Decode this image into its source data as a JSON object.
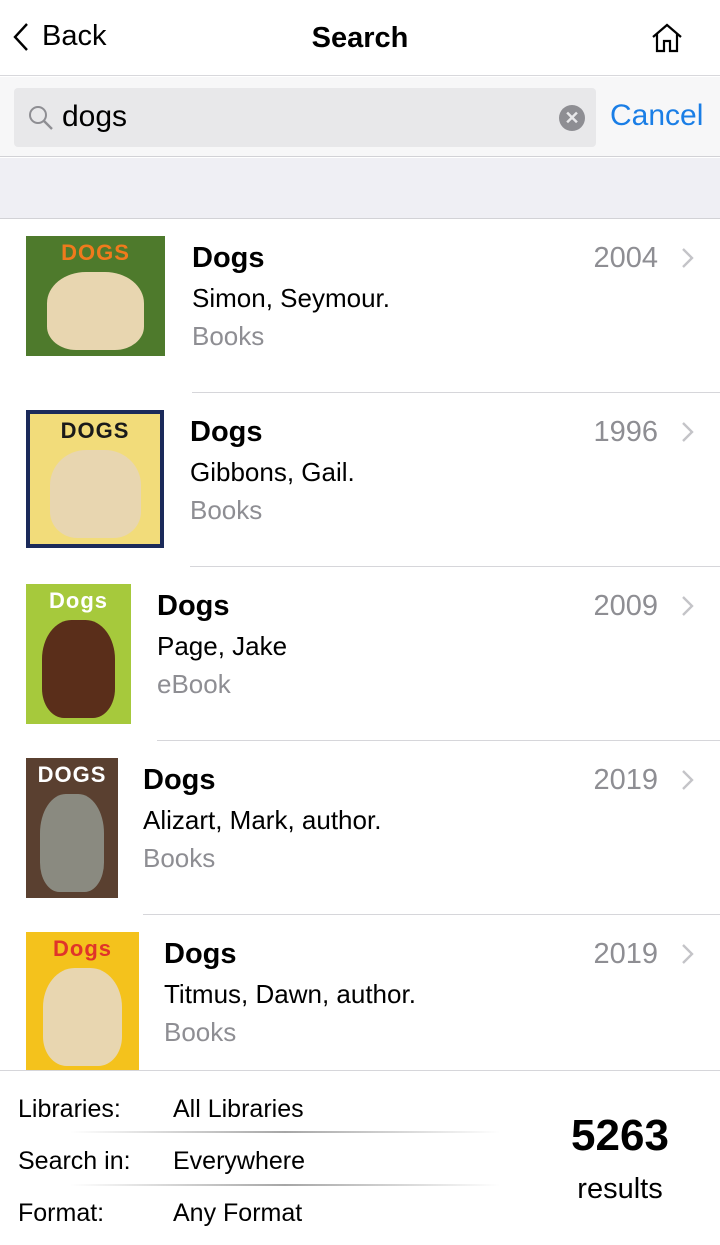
{
  "nav": {
    "back_label": "Back",
    "title": "Search",
    "home_icon": "home-icon"
  },
  "search": {
    "query": "dogs",
    "cancel_label": "Cancel"
  },
  "results": [
    {
      "title": "Dogs",
      "author": "Simon, Seymour.",
      "format": "Books",
      "year": "2004",
      "cover_text": "DOGS",
      "cover_bg": "#4e7a2c",
      "cover_title_color": "#f07a1c"
    },
    {
      "title": "Dogs",
      "author": "Gibbons, Gail.",
      "format": "Books",
      "year": "1996",
      "cover_text": "DOGS",
      "cover_bg": "#f2dc7a",
      "cover_title_color": "#1a1a1a"
    },
    {
      "title": "Dogs",
      "author": "Page, Jake",
      "format": "eBook",
      "year": "2009",
      "cover_text": "Dogs",
      "cover_bg": "#a6c93c",
      "cover_title_color": "#ffffff"
    },
    {
      "title": "Dogs",
      "author": "Alizart, Mark, author.",
      "format": "Books",
      "year": "2019",
      "cover_text": "DOGS",
      "cover_bg": "#5a4030",
      "cover_title_color": "#ffffff"
    },
    {
      "title": "Dogs",
      "author": "Titmus, Dawn, author.",
      "format": "Books",
      "year": "2019",
      "cover_text": "Dogs",
      "cover_bg": "#f4c21c",
      "cover_title_color": "#e0342a"
    }
  ],
  "footer": {
    "libraries_label": "Libraries:",
    "libraries_value": "All Libraries",
    "search_in_label": "Search in:",
    "search_in_value": "Everywhere",
    "format_label": "Format:",
    "format_value": "Any Format",
    "count": "5263",
    "count_label": "results"
  },
  "colors": {
    "accent": "#1a7ee6",
    "secondary_text": "#8e8e93"
  }
}
